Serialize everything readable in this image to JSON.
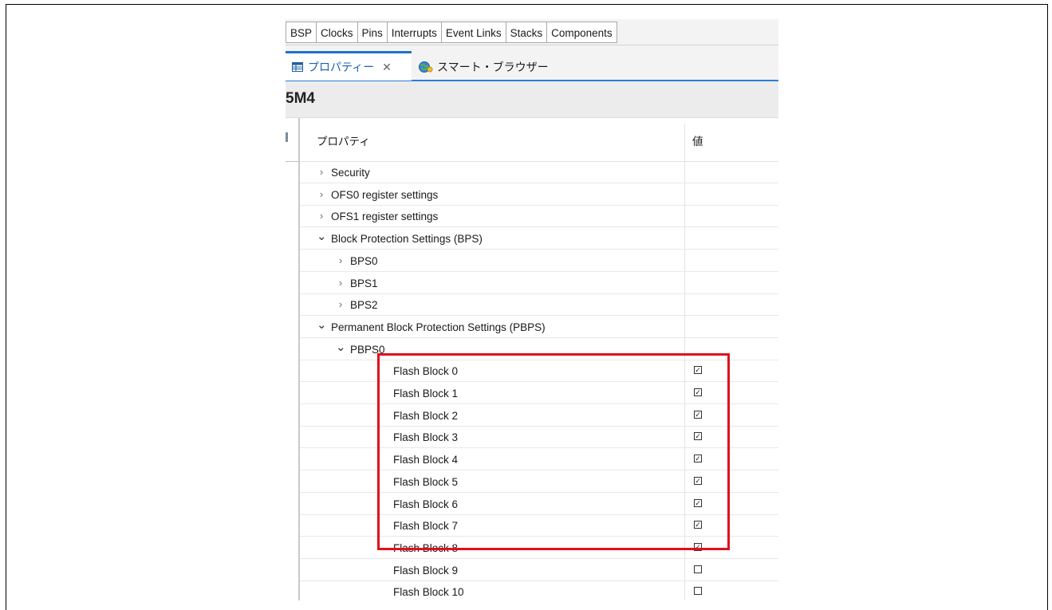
{
  "tabbar": {
    "tabs": [
      "BSP",
      "Clocks",
      "Pins",
      "Interrupts",
      "Event Links",
      "Stacks",
      "Components"
    ]
  },
  "viewtabs": {
    "active_label": "プロパティー",
    "active_close": "✕",
    "second_label": "スマート・ブラウザー"
  },
  "page_title": "5M4",
  "table": {
    "col_property": "プロパティ",
    "col_value": "値",
    "rows": [
      {
        "label": "Security",
        "arrow": "›",
        "level": 0,
        "value": null
      },
      {
        "label": "OFS0 register settings",
        "arrow": "›",
        "level": 0,
        "value": null
      },
      {
        "label": "OFS1 register settings",
        "arrow": "›",
        "level": 0,
        "value": null
      },
      {
        "label": "Block Protection Settings (BPS)",
        "arrow": "⌄",
        "level": 0,
        "value": null
      },
      {
        "label": "BPS0",
        "arrow": "›",
        "level": 1,
        "value": null
      },
      {
        "label": "BPS1",
        "arrow": "›",
        "level": 1,
        "value": null
      },
      {
        "label": "BPS2",
        "arrow": "›",
        "level": 1,
        "value": null
      },
      {
        "label": "Permanent Block Protection Settings (PBPS)",
        "arrow": "⌄",
        "level": 0,
        "value": null
      },
      {
        "label": "PBPS0",
        "arrow": "⌄",
        "level": 1,
        "value": null
      },
      {
        "label": "Flash Block 0",
        "arrow": "",
        "level": 2,
        "value": true
      },
      {
        "label": "Flash Block 1",
        "arrow": "",
        "level": 2,
        "value": true
      },
      {
        "label": "Flash Block 2",
        "arrow": "",
        "level": 2,
        "value": true
      },
      {
        "label": "Flash Block 3",
        "arrow": "",
        "level": 2,
        "value": true
      },
      {
        "label": "Flash Block 4",
        "arrow": "",
        "level": 2,
        "value": true
      },
      {
        "label": "Flash Block 5",
        "arrow": "",
        "level": 2,
        "value": true
      },
      {
        "label": "Flash Block 6",
        "arrow": "",
        "level": 2,
        "value": true
      },
      {
        "label": "Flash Block 7",
        "arrow": "",
        "level": 2,
        "value": true
      },
      {
        "label": "Flash Block 8",
        "arrow": "",
        "level": 2,
        "value": true
      },
      {
        "label": "Flash Block 9",
        "arrow": "",
        "level": 2,
        "value": false
      },
      {
        "label": "Flash Block 10",
        "arrow": "",
        "level": 2,
        "value": false
      }
    ]
  },
  "colors": {
    "accent": "#1f72c9",
    "highlight": "#e0101c",
    "tab_bg": "#f3f3f3"
  },
  "icons": {
    "properties_tab": "properties-table-icon",
    "smart_browser_tab": "smart-browser-globe-icon",
    "check": "checkbox-checked-icon"
  }
}
